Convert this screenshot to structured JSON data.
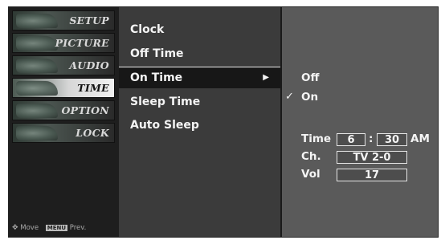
{
  "side_menu": {
    "items": [
      {
        "label": "SETUP"
      },
      {
        "label": "PICTURE"
      },
      {
        "label": "AUDIO"
      },
      {
        "label": "TIME"
      },
      {
        "label": "OPTION"
      },
      {
        "label": "LOCK"
      }
    ],
    "active": "TIME",
    "footer": {
      "move_icon": "move-dpad-icon",
      "move_label": "Move",
      "menu_key": "MENU",
      "prev_label": "Prev."
    }
  },
  "submenu": {
    "items": [
      {
        "label": "Clock"
      },
      {
        "label": "Off Time"
      },
      {
        "label": "On Time"
      },
      {
        "label": "Sleep Time"
      },
      {
        "label": "Auto Sleep"
      }
    ],
    "selected": "On Time",
    "arrow_icon": "▶"
  },
  "on_time_panel": {
    "options": [
      {
        "label": "Off",
        "checked": false
      },
      {
        "label": "On",
        "checked": true
      }
    ],
    "check_glyph": "✓",
    "time": {
      "label": "Time",
      "hour": "6",
      "separator": ":",
      "minute": "30",
      "ampm": "AM"
    },
    "channel": {
      "label": "Ch.",
      "value": "TV  2-0"
    },
    "volume": {
      "label": "Vol",
      "value": "17"
    }
  },
  "colors": {
    "osd_bg": "#3c3c3c",
    "panel_bg": "#5a5a5a",
    "selected_bg": "#171717",
    "text": "#f4f4f4"
  }
}
